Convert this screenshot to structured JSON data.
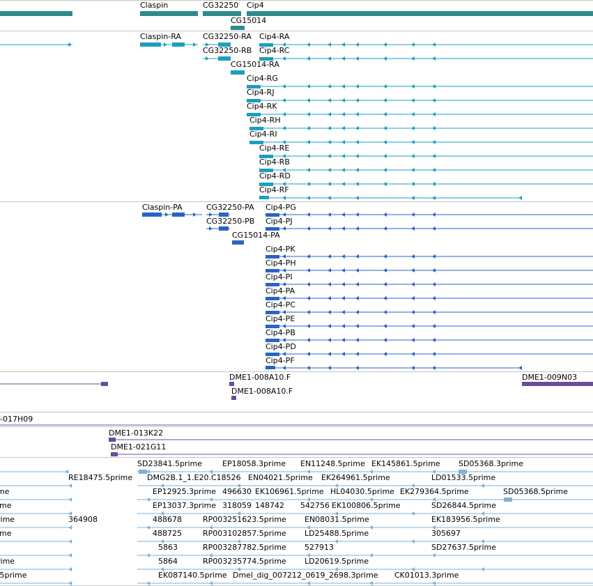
{
  "colors": {
    "gene": "#2e8b8b",
    "mrna": "#1a9fbf",
    "protein": "#2a63c7",
    "clone": "#6a4c9c",
    "est": "#7ab2dc",
    "divider": "#c4c4c4"
  },
  "tracks": {
    "genes": {
      "labels": [
        {
          "text": "Claspin"
        },
        {
          "text": "CG32250"
        },
        {
          "text": "Cip4"
        },
        {
          "text": "CG15014"
        }
      ]
    },
    "transcripts": {
      "labels": [
        {
          "text": "Claspin-RA"
        },
        {
          "text": "CG32250-RA"
        },
        {
          "text": "Cip4-RA"
        },
        {
          "text": "CG32250-RB"
        },
        {
          "text": "Cip4-RC"
        },
        {
          "text": "CG15014-RA"
        },
        {
          "text": "Cip4-RG"
        },
        {
          "text": "Cip4-RJ"
        },
        {
          "text": "Cip4-RK"
        },
        {
          "text": "Cip4-RH"
        },
        {
          "text": "Cip4-RI"
        },
        {
          "text": "Cip4-RE"
        },
        {
          "text": "Cip4-RB"
        },
        {
          "text": "Cip4-RD"
        },
        {
          "text": "Cip4-RF"
        }
      ]
    },
    "proteins": {
      "labels": [
        {
          "text": "Claspin-PA"
        },
        {
          "text": "CG32250-PA"
        },
        {
          "text": "Cip4-PG"
        },
        {
          "text": "CG32250-PB"
        },
        {
          "text": "Cip4-PJ"
        },
        {
          "text": "CG15014-PA"
        },
        {
          "text": "Cip4-PK"
        },
        {
          "text": "Cip4-PH"
        },
        {
          "text": "Cip4-PI"
        },
        {
          "text": "Cip4-PA"
        },
        {
          "text": "Cip4-PC"
        },
        {
          "text": "Cip4-PE"
        },
        {
          "text": "Cip4-PB"
        },
        {
          "text": "Cip4-PD"
        },
        {
          "text": "Cip4-PF"
        }
      ]
    },
    "clones": {
      "labels": [
        {
          "text": "DME1-008A10.F"
        },
        {
          "text": "DME1-009N03"
        },
        {
          "text": "DME1-008A10.F"
        }
      ]
    },
    "bacs": {
      "labels": [
        {
          "text": "-017H09"
        },
        {
          "text": "DME1-013K22"
        },
        {
          "text": "DME1-021G11"
        }
      ]
    },
    "ests": {
      "labels": [
        {
          "text": "SD23841.5prime"
        },
        {
          "text": "EP18058.3prime"
        },
        {
          "text": "EN11248.5prime"
        },
        {
          "text": "EK145861.5prime"
        },
        {
          "text": "SD05368.3prime"
        },
        {
          "text": "RE18475.5prime"
        },
        {
          "text": "DMG2B.1_1.E20.C18526"
        },
        {
          "text": "EN04021.5prime"
        },
        {
          "text": "EK264961.5prime"
        },
        {
          "text": "LD01533.5prime"
        },
        {
          "text": "EP12925.3prime"
        },
        {
          "text": "496630"
        },
        {
          "text": "EK106961.5prime"
        },
        {
          "text": "HL04030.5prime"
        },
        {
          "text": "EK279364.5prime"
        },
        {
          "text": "SD05368.5prime"
        },
        {
          "text": "EP13037.3prime"
        },
        {
          "text": "318059"
        },
        {
          "text": "148742"
        },
        {
          "text": "542756"
        },
        {
          "text": "EK100806.5prime"
        },
        {
          "text": "SD26844.5prime"
        },
        {
          "text": "364908"
        },
        {
          "text": "488678"
        },
        {
          "text": "RP003251623.5prime"
        },
        {
          "text": "EN08031.5prime"
        },
        {
          "text": "EK183956.5prime"
        },
        {
          "text": "488725"
        },
        {
          "text": "RP003102857.5prime"
        },
        {
          "text": "LD25488.5prime"
        },
        {
          "text": "305697"
        },
        {
          "text": "5863"
        },
        {
          "text": "RP003287782.5prime"
        },
        {
          "text": "527913"
        },
        {
          "text": "SD27637.5prime"
        },
        {
          "text": "5864"
        },
        {
          "text": "RP003235774.5prime"
        },
        {
          "text": "LD20619.5prime"
        },
        {
          "text": "EK087140.5prime"
        },
        {
          "text": "Dmel_dig_007212_0619_2698.3prime"
        },
        {
          "text": "CK01013.3prime"
        },
        {
          "text": "rime"
        },
        {
          "text": "ime"
        },
        {
          "text": "rime"
        },
        {
          "text": "me"
        },
        {
          "text": "ime"
        },
        {
          "text": ".5prime"
        }
      ]
    }
  }
}
